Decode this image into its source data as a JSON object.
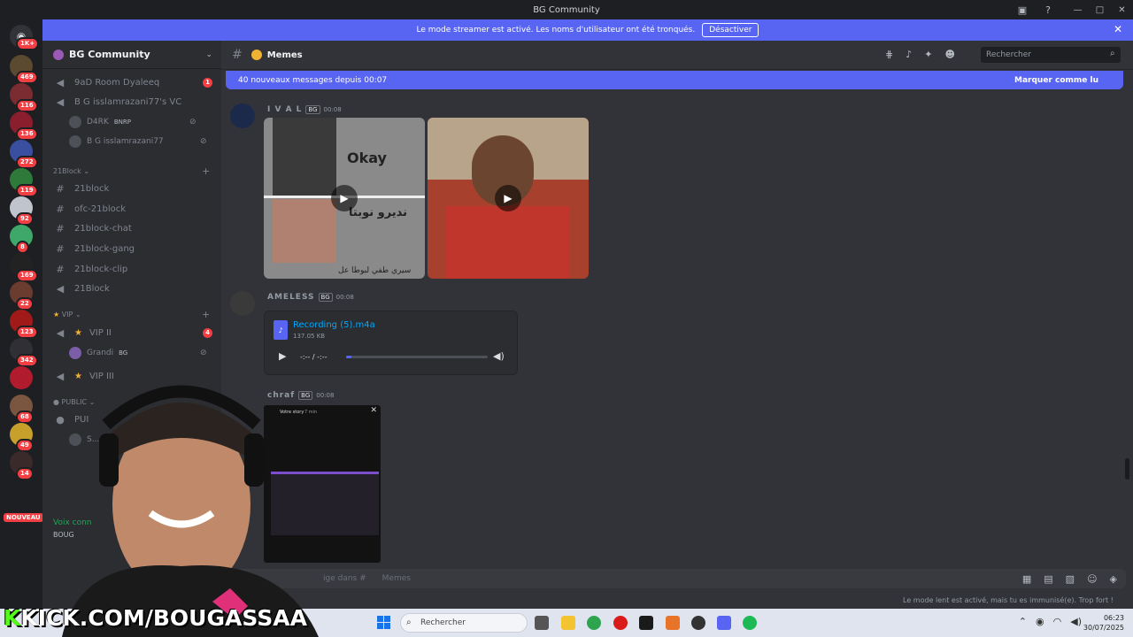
{
  "window": {
    "title": "BG Community"
  },
  "banner": {
    "text": "Le mode streamer est activé. Les noms d'utilisateur ont été tronqués.",
    "button": "Désactiver"
  },
  "server_badges": [
    "1K+",
    "469",
    "116",
    "136",
    "272",
    "119",
    "92",
    "8",
    "169",
    "22",
    "123",
    "342",
    "68",
    "49",
    "14"
  ],
  "new_label": "NOUVEAU",
  "guild": {
    "name": "BG Community"
  },
  "sidebar": {
    "voice1": "9aD Room Dyaleeq",
    "voice1_badge": "1",
    "voice2": "B G isslamrazani77's VC",
    "user1": "D4RK",
    "user1_tag": "BNRP",
    "user2": "B G isslamrazani77",
    "cat1": "21Block",
    "ch1": "21block",
    "ch2": "ofc-21block",
    "ch3": "21block-chat",
    "ch4": "21block-gang",
    "ch5": "21block-clip",
    "ch6": "21Block",
    "cat2": "VIP",
    "vip2": "VIP II",
    "vip2_badge": "4",
    "user3": "Grandi",
    "user3_tag": "BG",
    "vip3": "VIP III",
    "cat3": "PUBLIC",
    "pub1": "PUI",
    "user4": "S...",
    "voice_status": "Voix conn",
    "voice_channel": "BOUG"
  },
  "channel": {
    "name": "Memes"
  },
  "search": {
    "placeholder": "Rechercher"
  },
  "newbar": {
    "text": "40 nouveaux messages depuis 00:07",
    "action": "Marquer comme lu"
  },
  "messages": [
    {
      "user": "I V A L",
      "tag": "BG",
      "time": "00:08",
      "video1_text1": "Okay",
      "video1_text2": "نديرو نوبتا",
      "video1_text3": "سيري طفي لبوطا عل"
    },
    {
      "user": "AMELESS",
      "tag": "BG",
      "time": "00:08",
      "file": "Recording (5).m4a",
      "size": "137.05 KB",
      "playtime": "-:-- / -:--"
    },
    {
      "user": "chraf",
      "tag": "BG",
      "time": "00:08",
      "story_title": "Votre story",
      "story_sub": "7 min"
    }
  ],
  "composer": {
    "placeholder": "ige dans #",
    "channel": "Memes"
  },
  "slowmode": "Le mode lent est activé, mais tu es immunisé(e). Trop fort !",
  "taskbar": {
    "search_placeholder": "Rechercher",
    "time": "06:23",
    "date": "30/07/2025"
  },
  "overlay": {
    "kick_k": "K",
    "kick_rest": "KICK.COM/BOUGASSAA"
  },
  "colors": {
    "accent": "#5865f2",
    "kick": "#53fc18",
    "badge": "#f23f43"
  }
}
